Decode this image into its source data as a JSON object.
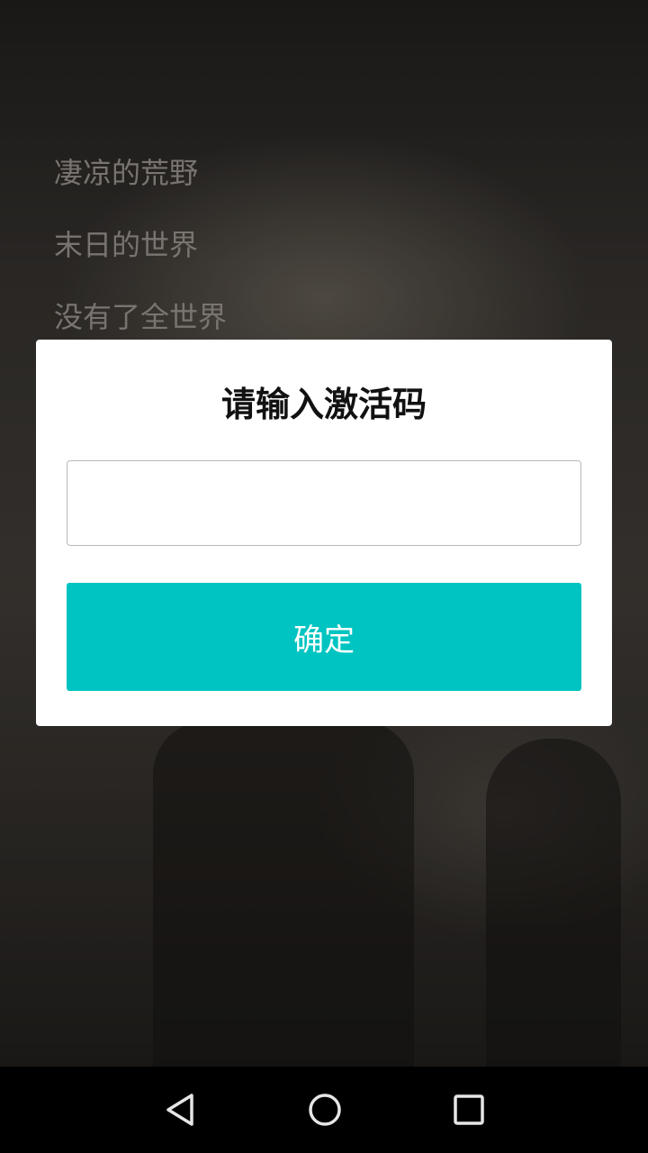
{
  "background": {
    "story_lines": [
      "凄凉的荒野",
      "末日的世界",
      "没有了全世界"
    ]
  },
  "dialog": {
    "title": "请输入激活码",
    "input_value": "",
    "input_placeholder": "",
    "confirm_label": "确定",
    "accent_color": "#00c4c1"
  },
  "nav_bar": {
    "back_icon": "triangle-back-icon",
    "home_icon": "circle-home-icon",
    "recents_icon": "square-recents-icon"
  }
}
